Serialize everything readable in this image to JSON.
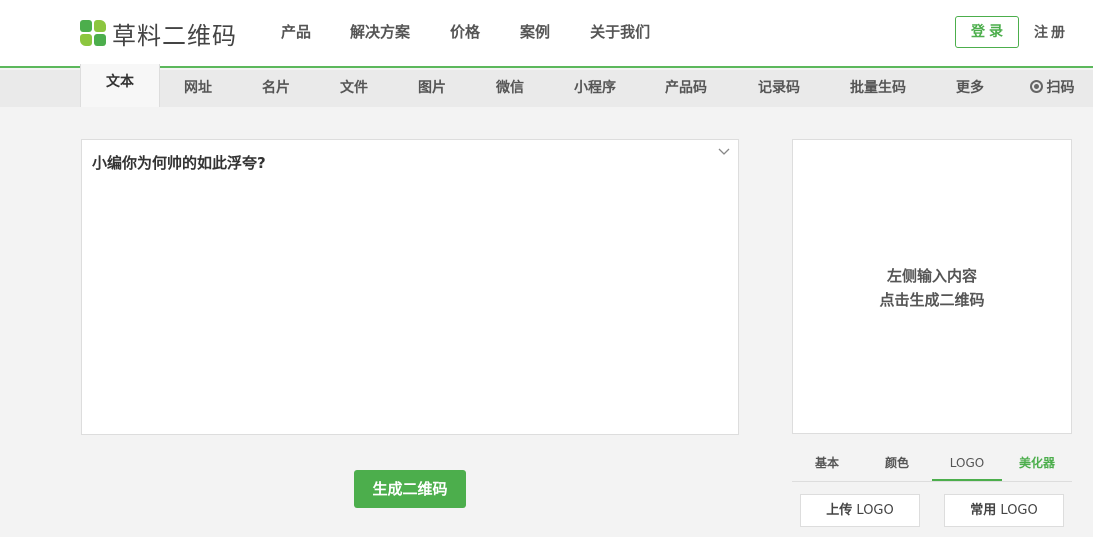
{
  "header": {
    "logo_text": "草料二维码",
    "nav": [
      "产品",
      "解决方案",
      "价格",
      "案例",
      "关于我们"
    ],
    "login_label": "登录",
    "register_label": "注册"
  },
  "tabs": [
    "文本",
    "网址",
    "名片",
    "文件",
    "图片",
    "微信",
    "小程序",
    "产品码",
    "记录码",
    "批量生码",
    "更多",
    "扫码"
  ],
  "editor": {
    "content": "小编你为何帅的如此浮夸?"
  },
  "generate_label": "生成二维码",
  "preview": {
    "hint_line1": "左侧输入内容",
    "hint_line2": "点击生成二维码"
  },
  "style_tabs": [
    "基本",
    "颜色",
    "LOGO",
    "美化器"
  ],
  "logo_buttons": {
    "upload_prefix": "上传",
    "upload_suffix": " LOGO",
    "common_prefix": "常用",
    "common_suffix": " LOGO"
  },
  "colors": {
    "accent": "#4cae4c",
    "accent_light": "#8cc63f"
  }
}
